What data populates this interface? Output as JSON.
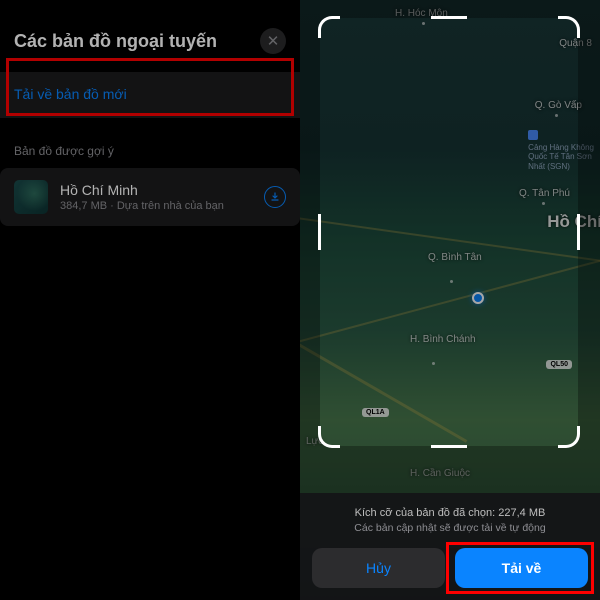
{
  "left": {
    "header_title": "Các bản đồ ngoại tuyến",
    "close_glyph": "✕",
    "download_new_label": "Tải về bản đồ mới",
    "suggested_label": "Bản đồ được gợi ý",
    "suggested_item": {
      "title": "Hồ Chí Minh",
      "subtitle": "384,7 MB · Dựa trên nhà của bạn"
    }
  },
  "right": {
    "labels": {
      "hoc_mon": "H. Hóc Môn",
      "quan_8": "Quận 8",
      "go_vap": "Q. Gò Vấp",
      "tan_phu": "Q. Tân Phú",
      "binh_tan": "Q. Bình Tân",
      "binh_chanh": "H. Bình Chánh",
      "can_giuoc": "H. Cần Giuộc",
      "city": "Hồ Chí",
      "airport_l1": "Cảng Hàng Không",
      "airport_l2": "Quốc Tế Tân Sơn",
      "airport_l3": "Nhất (SGN)",
      "route_a": "QL50",
      "route_b": "QL1A",
      "luc_label": "Lực"
    },
    "bottom": {
      "size_line": "Kích cỡ của bản đồ đã chọn: 227,4 MB",
      "auto_line": "Các bản cập nhật sẽ được tải về tự động",
      "cancel": "Hủy",
      "download": "Tải về"
    }
  }
}
